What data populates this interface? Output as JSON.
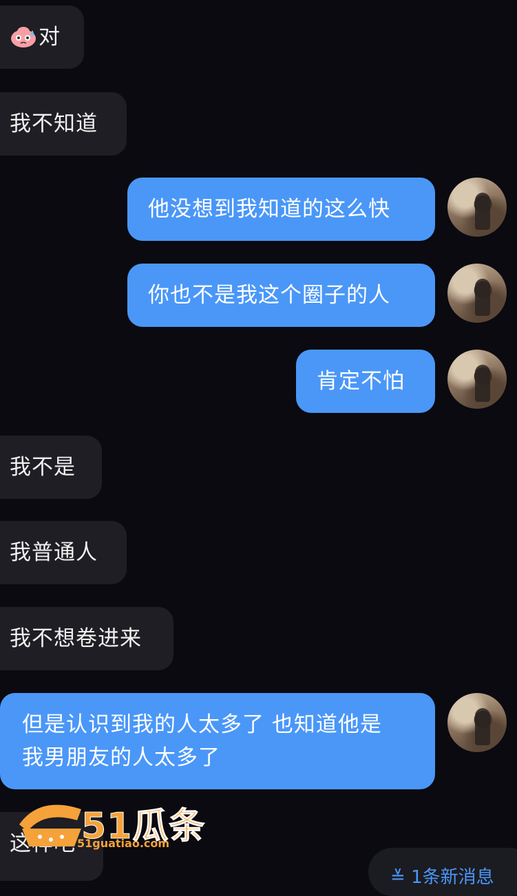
{
  "messages": [
    {
      "side": "in",
      "text": "对",
      "emoji": "sweat-face-icon"
    },
    {
      "side": "in",
      "text": "我不知道"
    },
    {
      "side": "out",
      "text": "他没想到我知道的这么快"
    },
    {
      "side": "out",
      "text": "你也不是我这个圈子的人"
    },
    {
      "side": "out",
      "text": "肯定不怕"
    },
    {
      "side": "in",
      "text": "我不是"
    },
    {
      "side": "in",
      "text": "我普通人"
    },
    {
      "side": "in",
      "text": "我不想卷进来"
    },
    {
      "side": "out",
      "line1": "但是认识到我的人太多了 也知道他是",
      "line2": "我男朋友的人太多了"
    },
    {
      "side": "in",
      "text": "这样吧"
    }
  ],
  "watermark": {
    "brand": "51瓜条",
    "url": "51guatiao.com"
  },
  "new_message_pill": {
    "icon": "double-chevron-down-icon",
    "label": "1条新消息"
  },
  "colors": {
    "background": "#0a0a10",
    "incoming": "#1e1e24",
    "outgoing": "#4a97f8"
  }
}
